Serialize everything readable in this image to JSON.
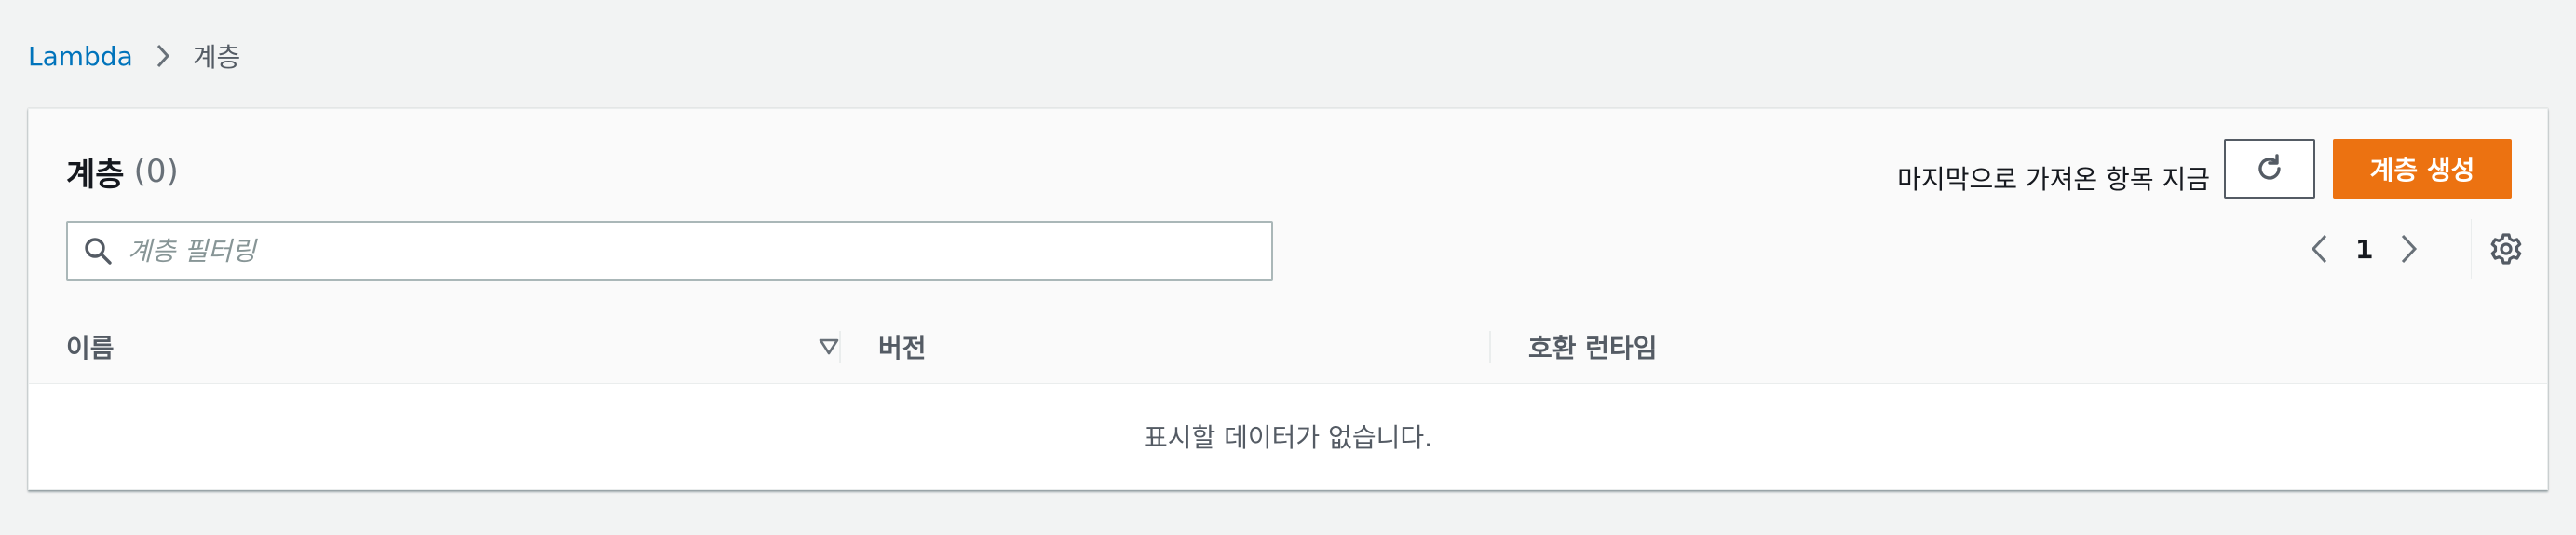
{
  "breadcrumb": {
    "items": [
      {
        "label": "Lambda"
      },
      {
        "label": "계층"
      }
    ]
  },
  "panel": {
    "title": "계층",
    "count": "(0)",
    "last_fetched": "마지막으로 가져온 항목 지금",
    "refresh_icon": "refresh-icon",
    "create_label": "계층 생성",
    "search": {
      "placeholder": "계층 필터링",
      "value": "",
      "icon": "search-icon"
    },
    "pagination": {
      "current_page": "1",
      "prev_icon": "chevron-left-icon",
      "next_icon": "chevron-right-icon"
    },
    "settings_icon": "gear-icon"
  },
  "table": {
    "columns": [
      {
        "label": "이름",
        "sort_icon": "sort-down-icon"
      },
      {
        "label": "버전"
      },
      {
        "label": "호환 런타임"
      }
    ],
    "rows": [],
    "empty_message": "표시할 데이터가 없습니다."
  },
  "colors": {
    "page_bg": "#f2f3f3",
    "link": "#0073bb",
    "primary_button": "#ec7211",
    "header_bg": "#fafafa"
  }
}
